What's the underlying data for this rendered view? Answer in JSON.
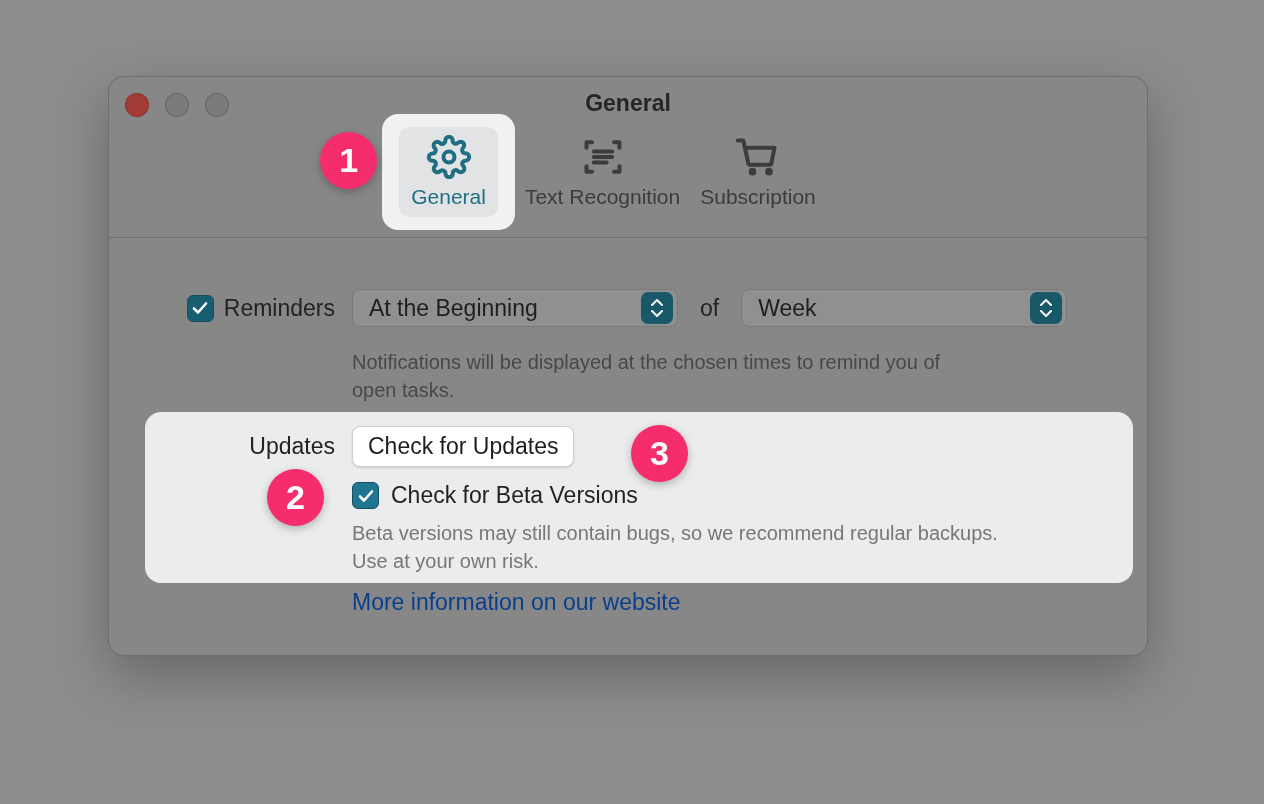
{
  "window": {
    "title": "General",
    "buttons": [
      {
        "kind": "close"
      },
      {
        "kind": "minimize"
      },
      {
        "kind": "zoom"
      }
    ]
  },
  "tabs": [
    {
      "label": "General",
      "selected": true,
      "highlighted": true,
      "callout": "1"
    },
    {
      "label": "Text Recognition",
      "selected": false,
      "highlighted": false
    },
    {
      "label": "Subscription",
      "selected": false,
      "highlighted": false
    }
  ],
  "reminders": {
    "label": "Reminders",
    "checked": true,
    "highlighted": false,
    "timing": "At the Beginning",
    "connector": "of",
    "period": "Week",
    "hint": "Notifications will be displayed at the chosen times to remind you of open tasks."
  },
  "updates": {
    "label": "Updates",
    "highlighted": true,
    "button": "Check for Updates",
    "button_callout": "3",
    "beta": {
      "label": "Check for Beta Versions",
      "checked": true,
      "callout": "2"
    },
    "hint": "Beta versions may still contain bugs, so we recommend regular backups. Use at your own risk."
  },
  "link": "More information on our website"
}
